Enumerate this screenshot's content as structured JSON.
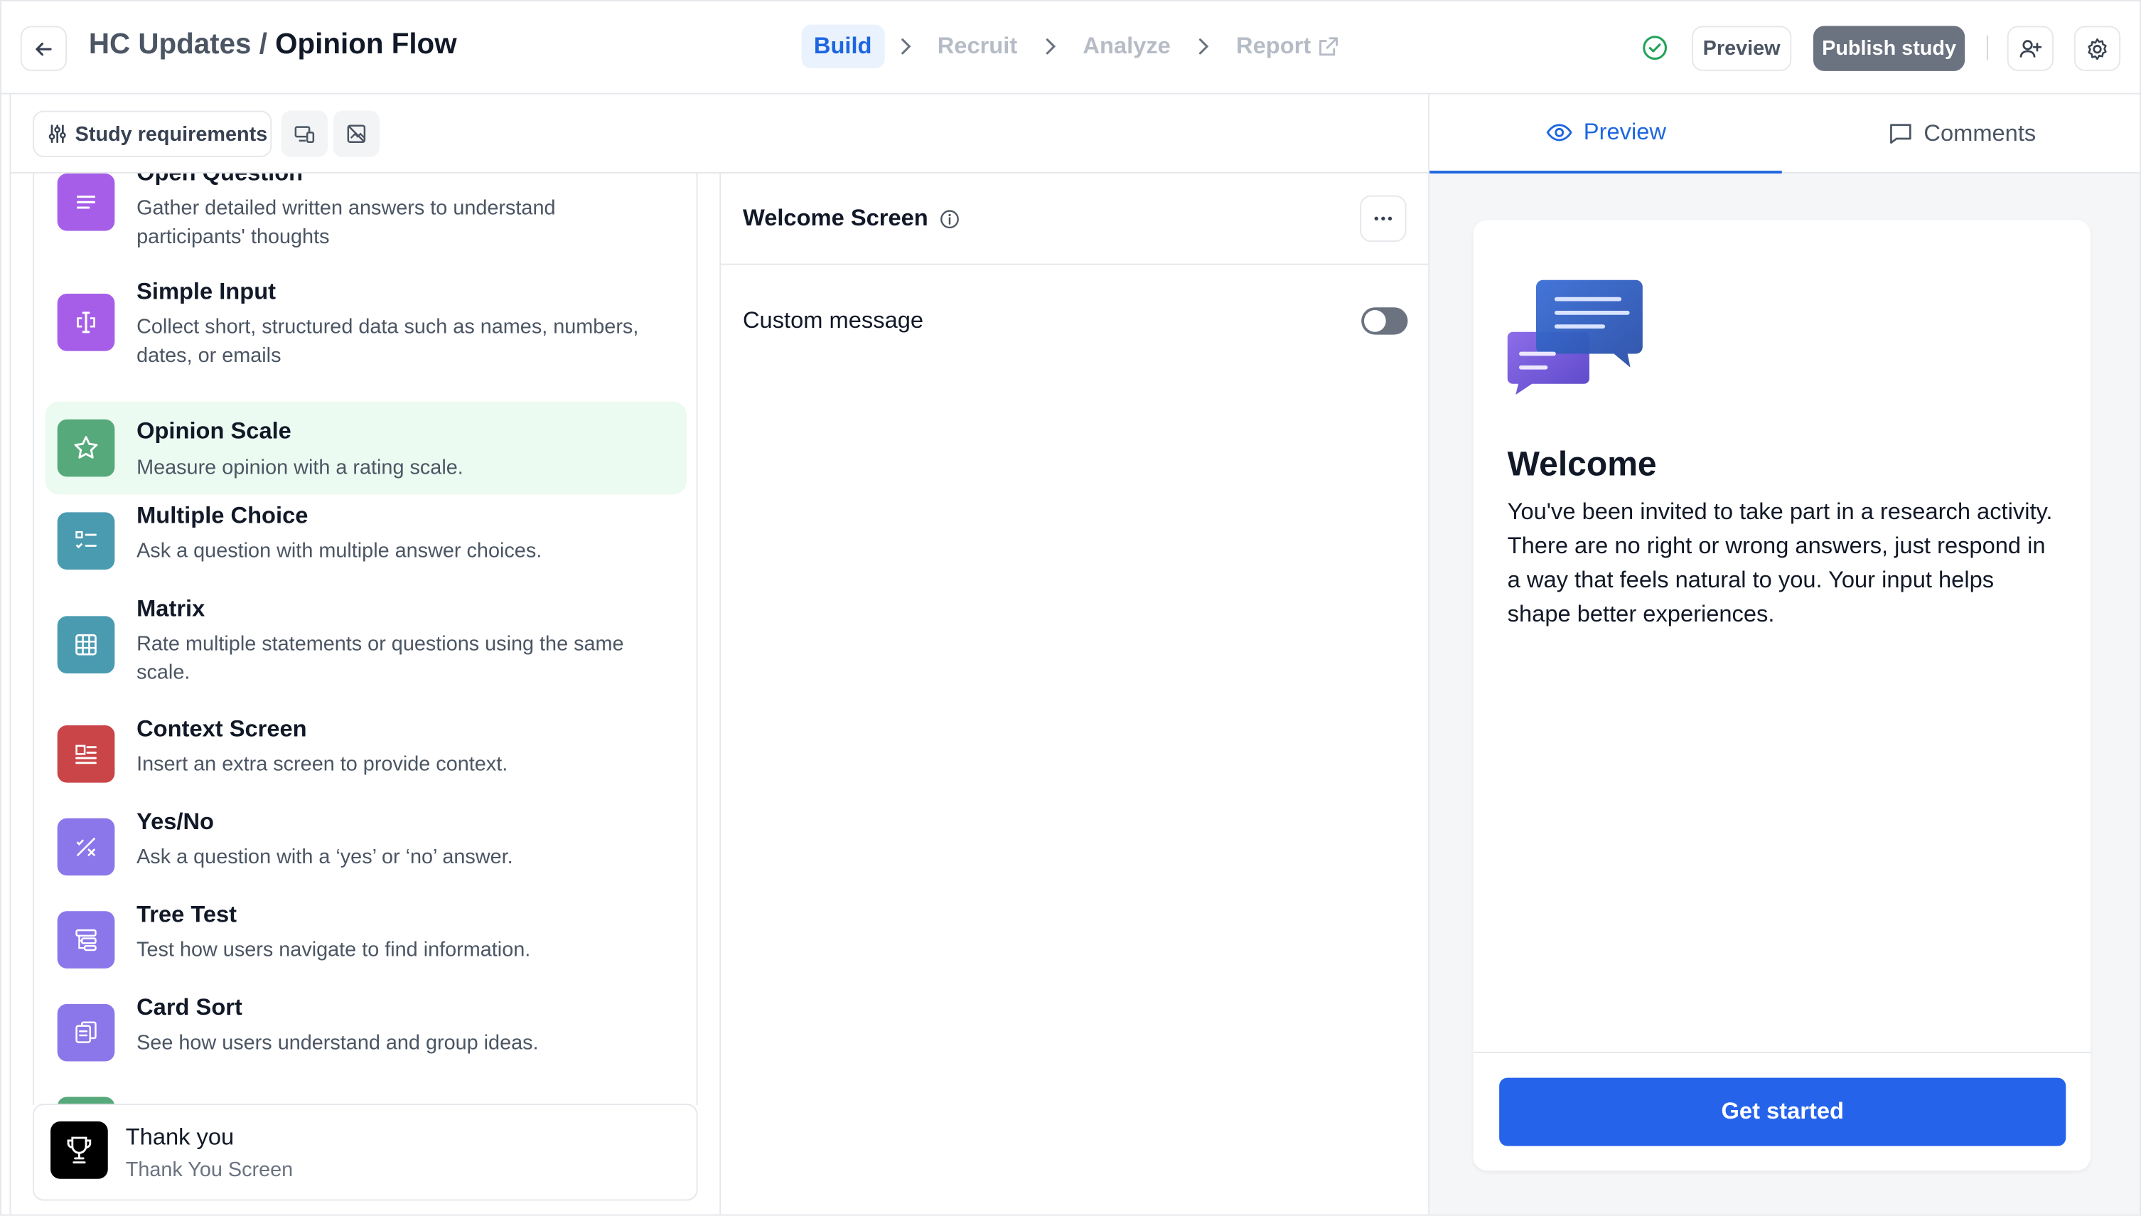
{
  "header": {
    "breadcrumb_parent": "HC Updates",
    "breadcrumb_separator": " / ",
    "breadcrumb_current": "Opinion Flow",
    "steps": [
      "Build",
      "Recruit",
      "Analyze",
      "Report"
    ],
    "active_step": "Build",
    "preview_label": "Preview",
    "publish_label": "Publish study",
    "accent_color": "#1d66e0"
  },
  "toolbar": {
    "requirements_label": "Study requirements"
  },
  "question_types": [
    {
      "title": "Open Question",
      "desc": "Gather detailed written answers to understand participants' thoughts",
      "color": "#a65ee8",
      "icon": "text-lines-icon"
    },
    {
      "title": "Simple Input",
      "desc": "Collect short, structured data such as names, numbers, dates, or emails",
      "color": "#a65ee8",
      "icon": "text-cursor-icon"
    },
    {
      "title": "Opinion Scale",
      "desc": "Measure opinion with a rating scale.",
      "color": "#56a97a",
      "icon": "star-icon"
    },
    {
      "title": "Multiple Choice",
      "desc": "Ask a question with multiple answer choices.",
      "color": "#4a9bb0",
      "icon": "checklist-icon"
    },
    {
      "title": "Matrix",
      "desc": "Rate multiple statements or questions using the same scale.",
      "color": "#4a9bb0",
      "icon": "grid-icon"
    },
    {
      "title": "Context Screen",
      "desc": "Insert an extra screen to provide context.",
      "color": "#c94548",
      "icon": "context-icon"
    },
    {
      "title": "Yes/No",
      "desc": "Ask a question with a ‘yes’ or ‘no’ answer.",
      "color": "#8b77ea",
      "icon": "yes-no-icon"
    },
    {
      "title": "Tree Test",
      "desc": "Test how users navigate to find information.",
      "color": "#8b77ea",
      "icon": "tree-icon"
    },
    {
      "title": "Card Sort",
      "desc": "See how users understand and group ideas.",
      "color": "#8b77ea",
      "icon": "cards-icon"
    }
  ],
  "selected_question_type": "Opinion Scale",
  "thank_you": {
    "title": "Thank you",
    "subtitle": "Thank You Screen"
  },
  "editor": {
    "title": "Welcome Screen",
    "custom_message_label": "Custom message",
    "custom_message_enabled": false
  },
  "preview_panel": {
    "tabs": [
      "Preview",
      "Comments"
    ],
    "active_tab": "Preview",
    "welcome_title": "Welcome",
    "welcome_body": "You've been invited to take part in a research activity. There are no right or wrong answers, just respond in a way that feels natural to you. Your input helps shape better experiences.",
    "cta_label": "Get started",
    "cta_color": "#2563eb"
  }
}
